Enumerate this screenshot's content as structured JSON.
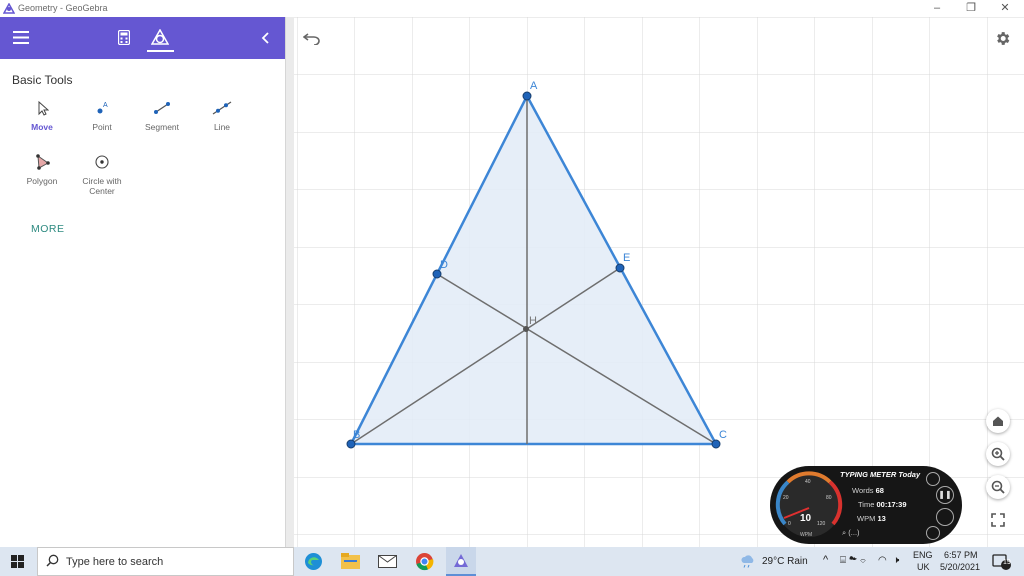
{
  "window": {
    "title": "Geometry - GeoGebra",
    "controls": [
      "minimize",
      "restore",
      "close"
    ]
  },
  "sidebar": {
    "toolbar_icons": [
      "menu-icon",
      "calculator-icon",
      "geometry-tools-icon",
      "collapse-chevron-icon"
    ],
    "section_title": "Basic Tools",
    "tools": [
      {
        "label": "Move",
        "icon": "move-arrow-icon",
        "active": true
      },
      {
        "label": "Point",
        "icon": "point-icon",
        "active": false
      },
      {
        "label": "Segment",
        "icon": "segment-icon",
        "active": false
      },
      {
        "label": "Line",
        "icon": "line-icon",
        "active": false
      },
      {
        "label": "Polygon",
        "icon": "polygon-icon",
        "active": false
      },
      {
        "label": "Circle with",
        "label2": "Center",
        "icon": "circle-icon",
        "active": false
      }
    ],
    "more_label": "MORE"
  },
  "canvas": {
    "points": [
      {
        "name": "A"
      },
      {
        "name": "B"
      },
      {
        "name": "C"
      },
      {
        "name": "D"
      },
      {
        "name": "E"
      },
      {
        "name": "H"
      }
    ],
    "buttons": [
      "undo-icon",
      "settings-icon",
      "home-icon",
      "zoom-in-icon",
      "zoom-out-icon",
      "fullscreen-icon"
    ]
  },
  "typing_meter": {
    "title": "TYPING METER Today",
    "words_label": "Words",
    "words_value": "68",
    "time_label": "Time",
    "time_value": "00:17:39",
    "wpm_label": "WPM",
    "wpm_value": "13",
    "gauge_value": "10",
    "gauge_unit": "WPM",
    "gauge_ticks": [
      "0",
      "20",
      "40",
      "80",
      "120"
    ],
    "footer": "(...)"
  },
  "taskbar": {
    "search_placeholder": "Type here to search",
    "apps": [
      "edge-icon",
      "file-explorer-icon",
      "mail-icon",
      "chrome-icon",
      "geogebra-icon"
    ],
    "weather": "29°C  Rain",
    "language": "ENG",
    "region": "UK",
    "time": "6:57 PM",
    "date": "5/20/2021",
    "notifications": "19"
  },
  "colors": {
    "toolbar": "#6557d2",
    "triangle_stroke": "#3d86d6",
    "triangle_fill": "#e2ebf7",
    "point_fill": "#1f63b8",
    "teal_more": "#2d8a80"
  }
}
